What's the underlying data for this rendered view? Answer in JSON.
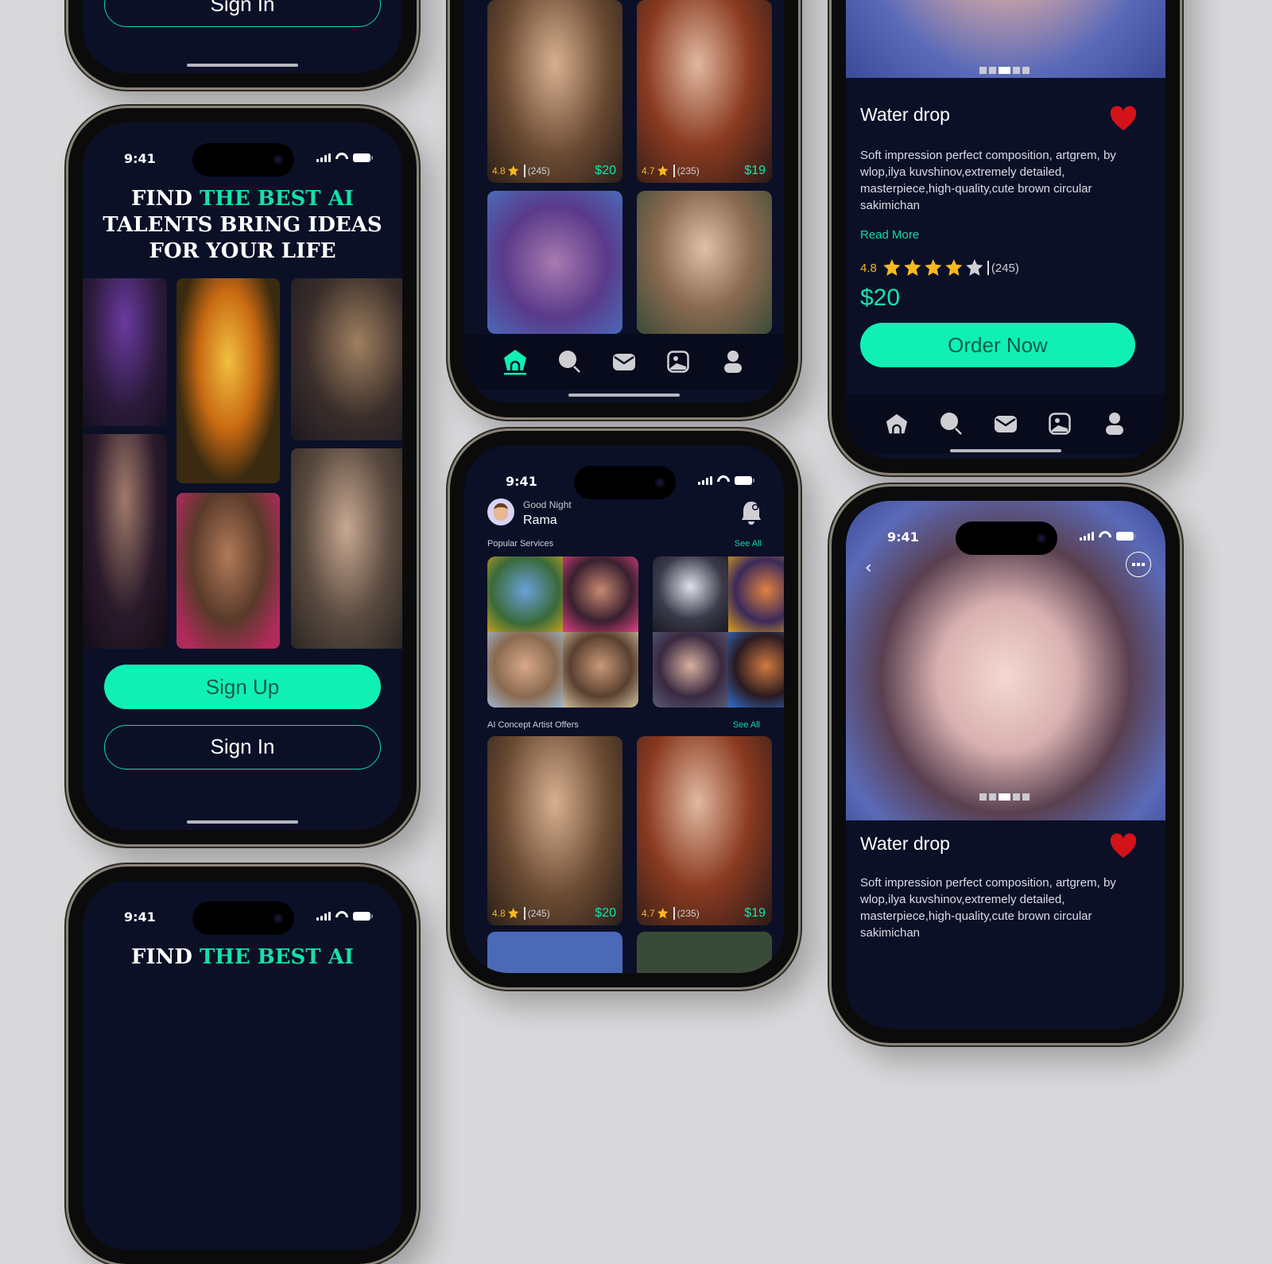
{
  "status": {
    "time": "9:41"
  },
  "onboarding": {
    "headline_white_1": "FIND ",
    "headline_accent": "THE BEST AI",
    "headline_line_2": "TALENTS BRING IDEAS",
    "headline_line_3": "FOR YOUR LIFE",
    "sign_up_label": "Sign Up",
    "sign_in_label": "Sign In"
  },
  "home": {
    "greeting": "Good Night",
    "user_name": "Rama",
    "popular_section": "Popular Services",
    "offers_section": "AI Concept Artist Offers",
    "see_all": "See All",
    "offers": [
      {
        "rating": "4.8",
        "count": "(245)",
        "price": "$20"
      },
      {
        "rating": "4.7",
        "count": "(235)",
        "price": "$19"
      }
    ]
  },
  "nav": {
    "items": [
      "home-icon",
      "search-icon",
      "mail-icon",
      "gallery-icon",
      "profile-icon"
    ],
    "active": "home"
  },
  "detail": {
    "title": "Water drop",
    "description": "Soft impression perfect composition, artgrem, by wlop,ilya kuvshinov,extremely detailed, masterpiece,high-quality,cute brown circular sakimichan",
    "read_more": "Read More",
    "rating": "4.8",
    "stars_filled": 4,
    "stars_total": 5,
    "review_count": "(245)",
    "price": "$20",
    "order_label": "Order Now",
    "carousel_index": 3,
    "carousel_total": 5,
    "favorited": true
  },
  "colors": {
    "accent": "#10f0b5",
    "background": "#0b1027",
    "star": "#f8b820",
    "heart": "#d3121a"
  }
}
